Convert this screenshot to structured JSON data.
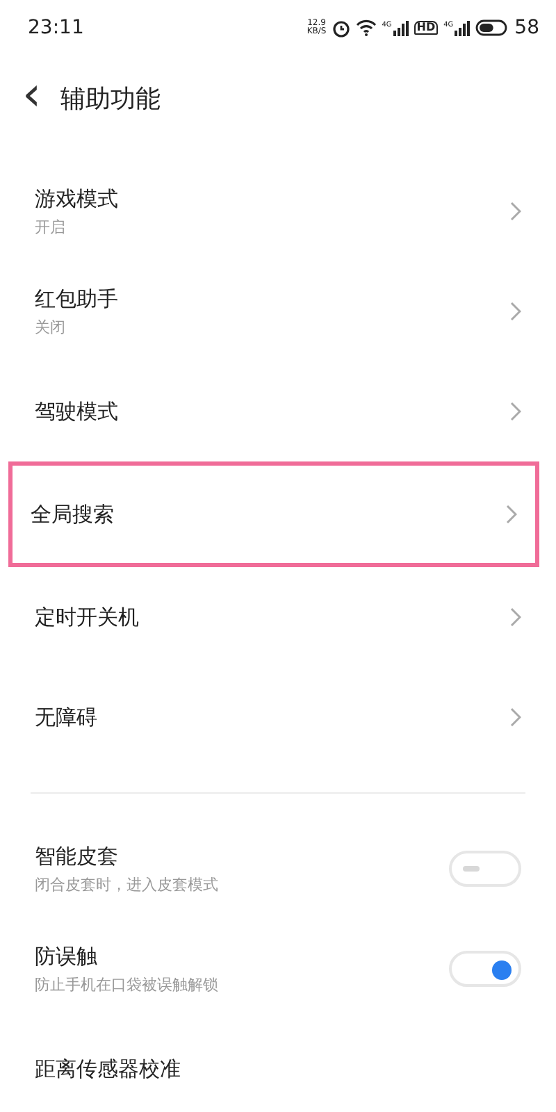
{
  "status_bar": {
    "time": "23:11",
    "speed_value": "12.9",
    "speed_unit": "KB/S",
    "signal_labels": [
      "4G",
      "4G"
    ],
    "hd_label": "HD",
    "battery": "58"
  },
  "header": {
    "back": "‹",
    "title": "辅助功能"
  },
  "items": [
    {
      "kind": "link",
      "title": "游戏模式",
      "subtitle": "开启",
      "highlighted": false
    },
    {
      "kind": "link",
      "title": "红包助手",
      "subtitle": "关闭",
      "highlighted": false
    },
    {
      "kind": "link",
      "title": "驾驶模式",
      "highlighted": false
    },
    {
      "kind": "link",
      "title": "全局搜索",
      "highlighted": true
    },
    {
      "kind": "link",
      "title": "定时开关机",
      "highlighted": false
    },
    {
      "kind": "link",
      "title": "无障碍",
      "highlighted": false
    },
    {
      "kind": "divider"
    },
    {
      "kind": "toggle",
      "title": "智能皮套",
      "subtitle": "闭合皮套时，进入皮套模式",
      "on": false
    },
    {
      "kind": "toggle",
      "title": "防误触",
      "subtitle": "防止手机在口袋被误触解锁",
      "on": true
    },
    {
      "kind": "plain",
      "title": "距离传感器校准"
    }
  ]
}
